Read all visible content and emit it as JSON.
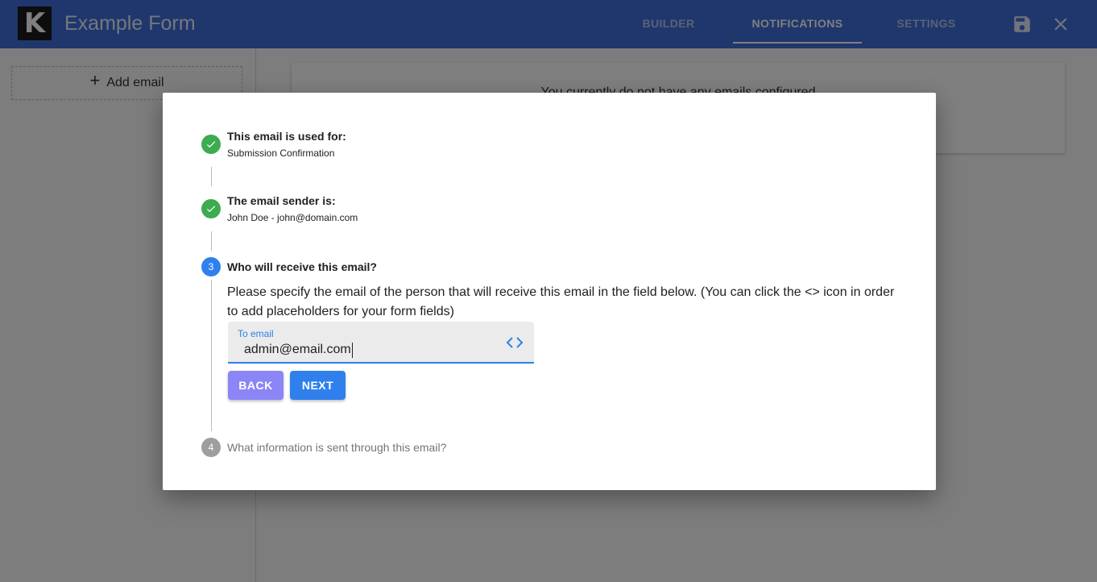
{
  "app": {
    "logo_letter": "K",
    "title": "Example Form"
  },
  "tabs": [
    {
      "label": "BUILDER",
      "active": false
    },
    {
      "label": "NOTIFICATIONS",
      "active": true
    },
    {
      "label": "SETTINGS",
      "active": false
    }
  ],
  "toolbar": {
    "save_icon": "save-icon",
    "close_icon": "close-icon"
  },
  "sidebar": {
    "add_email_label": "Add email"
  },
  "main": {
    "empty_message": "You currently do not have any emails configured"
  },
  "dialog": {
    "steps": [
      {
        "number": "1",
        "status": "completed",
        "title": "This email is used for:",
        "subtitle": "Submission Confirmation"
      },
      {
        "number": "2",
        "status": "completed",
        "title": "The email sender is:",
        "subtitle": "John Doe - john@domain.com"
      },
      {
        "number": "3",
        "status": "active",
        "title": "Who will receive this email?",
        "instructions": "Please specify the email of the person that will receive this email in the field below. (You can click the <> icon in order to add placeholders for your form fields)"
      },
      {
        "number": "4",
        "status": "pending",
        "title": "What information is sent through this email?"
      }
    ],
    "to_email": {
      "label": "To email",
      "value": "admin@email.com",
      "placeholder_icon": "code-brackets-icon"
    },
    "buttons": {
      "back": "BACK",
      "next": "NEXT"
    }
  },
  "colors": {
    "appbar": "#3f6fd8",
    "accent": "#2f80ed",
    "success": "#3dab4f",
    "back_button": "#8c85f5",
    "pending_step": "#9e9e9e"
  }
}
